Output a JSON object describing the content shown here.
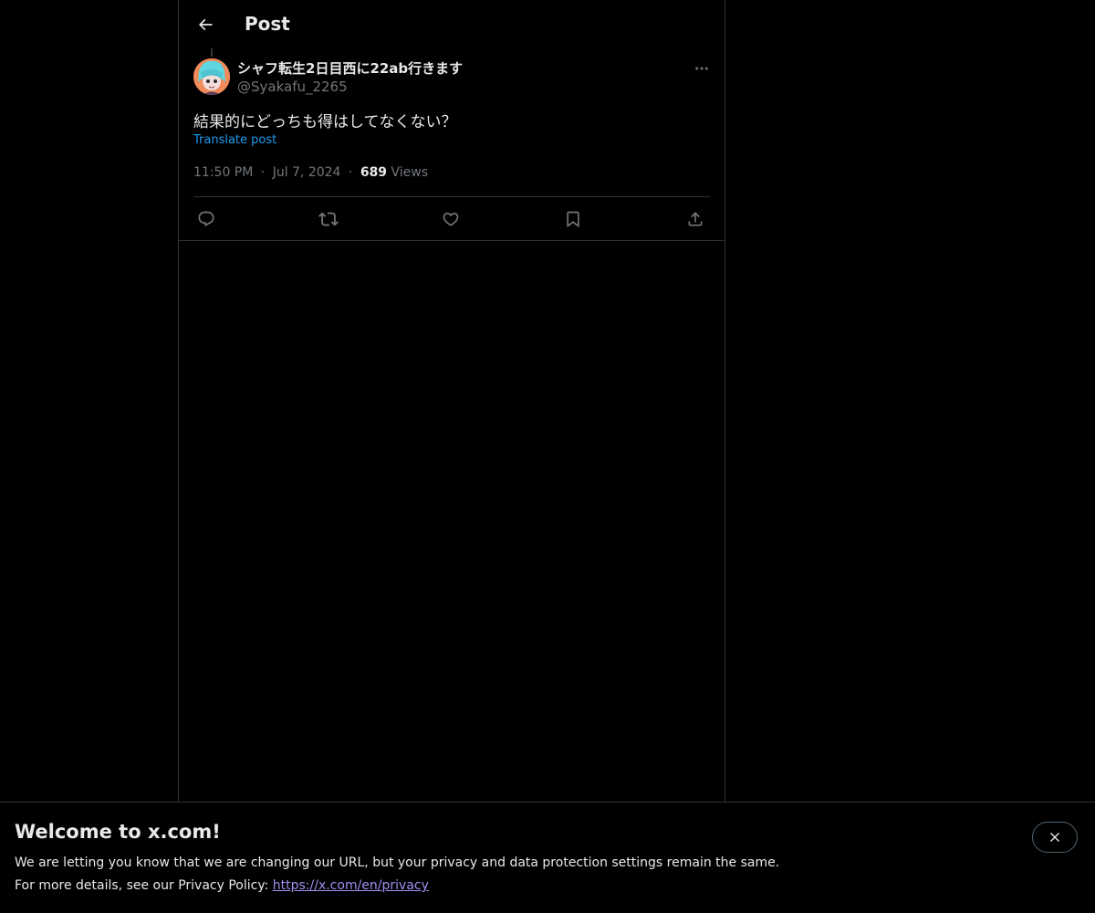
{
  "header": {
    "title": "Post",
    "back_icon": "arrow-left-icon"
  },
  "post": {
    "display_name": "シャフ転生2日目西に22ab行きます",
    "handle": "@Syakafu_2265",
    "text": "結果的にどっちも得はしてなくない？",
    "translate_label": "Translate post",
    "time": "11:50 PM",
    "date": "Jul 7, 2024",
    "separator": "·",
    "views_count": "689",
    "views_label": "Views",
    "more_icon": "more-horizontal-icon"
  },
  "actions": {
    "reply_icon": "reply-icon",
    "repost_icon": "repost-icon",
    "like_icon": "like-icon",
    "bookmark_icon": "bookmark-icon",
    "share_icon": "share-icon"
  },
  "banner": {
    "title": "Welcome to x.com!",
    "line1": "We are letting you know that we are changing our URL, but your privacy and data protection settings remain the same.",
    "line2_prefix": "For more details, see our Privacy Policy: ",
    "privacy_link": "https://x.com/en/privacy",
    "close_icon": "close-icon"
  },
  "colors": {
    "background": "#000000",
    "text_primary": "#e7e9ea",
    "text_secondary": "#71767b",
    "accent": "#1d9bf0",
    "border": "#2f3336",
    "link_visited": "#a38ef0"
  }
}
